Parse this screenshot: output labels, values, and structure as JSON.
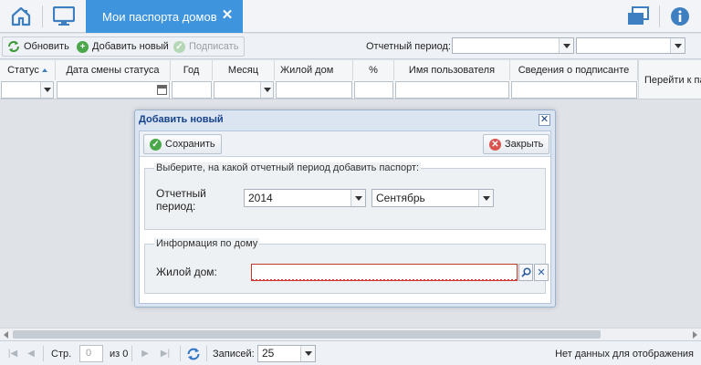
{
  "topbar": {
    "tab_title": "Мои паспорта домов",
    "icons": [
      "home-icon",
      "monitor-icon",
      "windows-icon",
      "info-icon"
    ],
    "accent_color": "#3e95dd"
  },
  "toolbar": {
    "refresh_label": "Обновить",
    "add_label": "Добавить новый",
    "sign_label": "Подписать",
    "period_label": "Отчетный период:"
  },
  "grid": {
    "columns": [
      "Статус",
      "Дата смены статуса",
      "Год",
      "Месяц",
      "Жилой дом",
      "%",
      "Имя пользователя",
      "Сведения о подписанте",
      "Перейти к па"
    ]
  },
  "pager": {
    "page_label": "Стр.",
    "page_value": "0",
    "of_label": "из 0",
    "records_label": "Записей:",
    "records_value": "25",
    "status": "Нет данных для отображения"
  },
  "dialog": {
    "title": "Добавить новый",
    "save_label": "Сохранить",
    "close_label": "Закрыть",
    "period_legend": "Выберите, на какой отчетный период добавить паспорт:",
    "period_label": "Отчетный период:",
    "year_value": "2014",
    "month_value": "Сентябрь",
    "house_legend": "Информация по дому",
    "house_label": "Жилой дом:",
    "house_value": ""
  }
}
